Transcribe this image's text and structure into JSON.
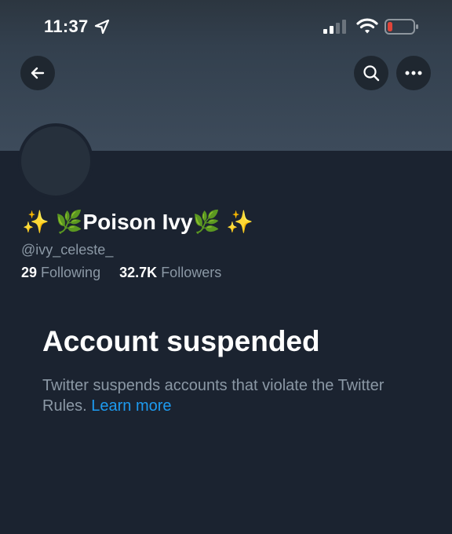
{
  "status_bar": {
    "time": "11:37",
    "icons": [
      "location-arrow-icon",
      "cellular-signal-icon",
      "wifi-icon",
      "battery-low-icon"
    ],
    "battery_color": "#e0453a"
  },
  "header": {
    "back_icon": "arrow-left-icon",
    "search_icon": "search-icon",
    "more_icon": "more-dots-icon"
  },
  "profile": {
    "display_name": "✨ 🌿Poison Ivy🌿 ✨",
    "handle": "@ivy_celeste_",
    "following_count": "29",
    "following_label": "Following",
    "followers_count": "32.7K",
    "followers_label": "Followers"
  },
  "suspension": {
    "title": "Account suspended",
    "message": "Twitter suspends accounts that violate the Twitter Rules.",
    "link_text": "Learn more"
  },
  "colors": {
    "background": "#1b2330",
    "banner": "#3d4b5b",
    "secondary_text": "#8b98a5",
    "link": "#1d9bf0"
  }
}
